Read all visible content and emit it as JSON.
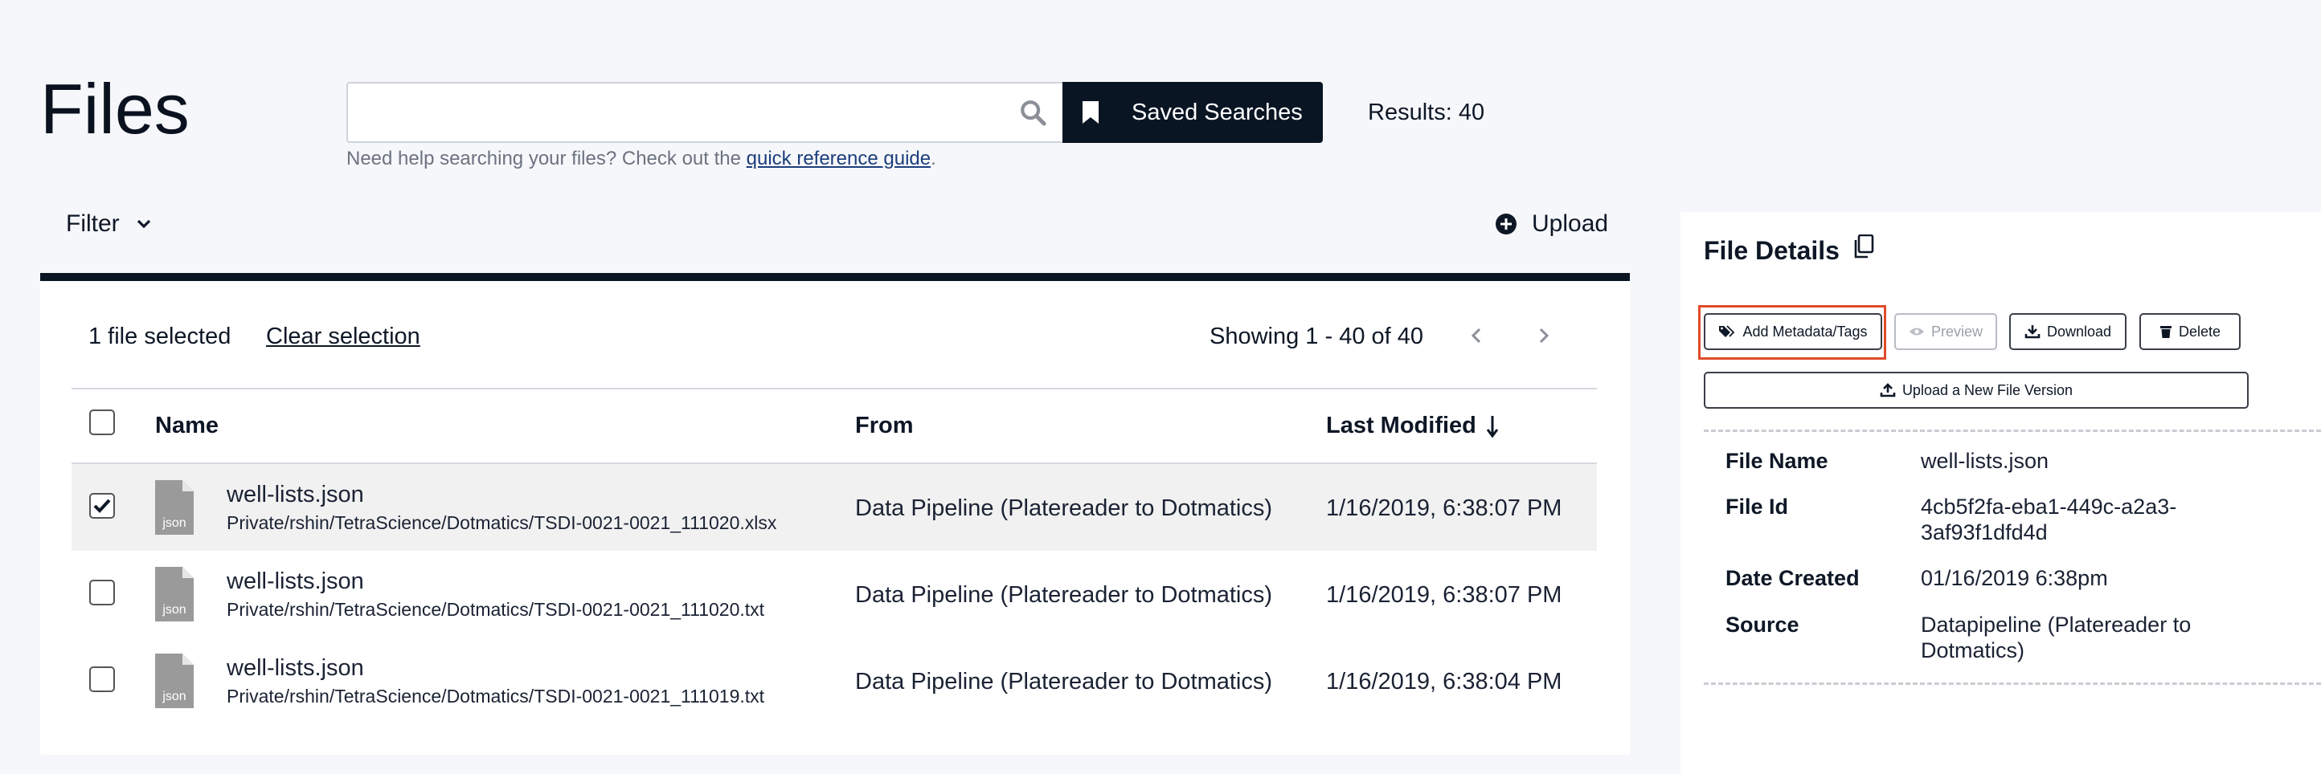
{
  "header": {
    "title": "Files",
    "search_value": "",
    "saved_searches_label": "Saved Searches",
    "results_label": "Results: 40",
    "help_prefix": "Need help searching your files? Check out the ",
    "help_link": "quick reference guide",
    "help_suffix": "."
  },
  "toolbar": {
    "filter_label": "Filter",
    "upload_label": "Upload"
  },
  "selection": {
    "count_label": "1 file selected",
    "clear_label": "Clear selection",
    "showing_label": "Showing 1 - 40 of 40"
  },
  "table": {
    "columns": [
      "Name",
      "From",
      "Last Modified"
    ],
    "rows": [
      {
        "icon_label": "json",
        "name": "well-lists.json",
        "path": "Private/rshin/TetraScience/Dotmatics/TSDI-0021-0021_111020.xlsx",
        "from": "Data Pipeline (Platereader to Dotmatics)",
        "modified": "1/16/2019, 6:38:07 PM",
        "selected": true
      },
      {
        "icon_label": "json",
        "name": "well-lists.json",
        "path": "Private/rshin/TetraScience/Dotmatics/TSDI-0021-0021_111020.txt",
        "from": "Data Pipeline (Platereader to Dotmatics)",
        "modified": "1/16/2019, 6:38:07 PM",
        "selected": false
      },
      {
        "icon_label": "json",
        "name": "well-lists.json",
        "path": "Private/rshin/TetraScience/Dotmatics/TSDI-0021-0021_111019.txt",
        "from": "Data Pipeline (Platereader to Dotmatics)",
        "modified": "1/16/2019, 6:38:04 PM",
        "selected": false
      }
    ]
  },
  "details": {
    "title": "File Details",
    "buttons": {
      "add_metadata": "Add Metadata/Tags",
      "preview": "Preview",
      "download": "Download",
      "delete": "Delete",
      "upload_version": "Upload a New File Version"
    },
    "fields": [
      {
        "label": "File Name",
        "value": "well-lists.json"
      },
      {
        "label": "File Id",
        "value_line1": "4cb5f2fa-eba1-449c-a2a3-",
        "value_line2": "3af93f1dfd4d"
      },
      {
        "label": "Date Created",
        "value": "01/16/2019 6:38pm"
      },
      {
        "label": "Source",
        "value_line1": "Datapipeline (Platereader to",
        "value_line2": "Dotmatics)"
      }
    ]
  },
  "colors": {
    "accent_dark": "#0a1523",
    "highlight": "#e04a2a",
    "selected_row": "#f1f1f1"
  }
}
